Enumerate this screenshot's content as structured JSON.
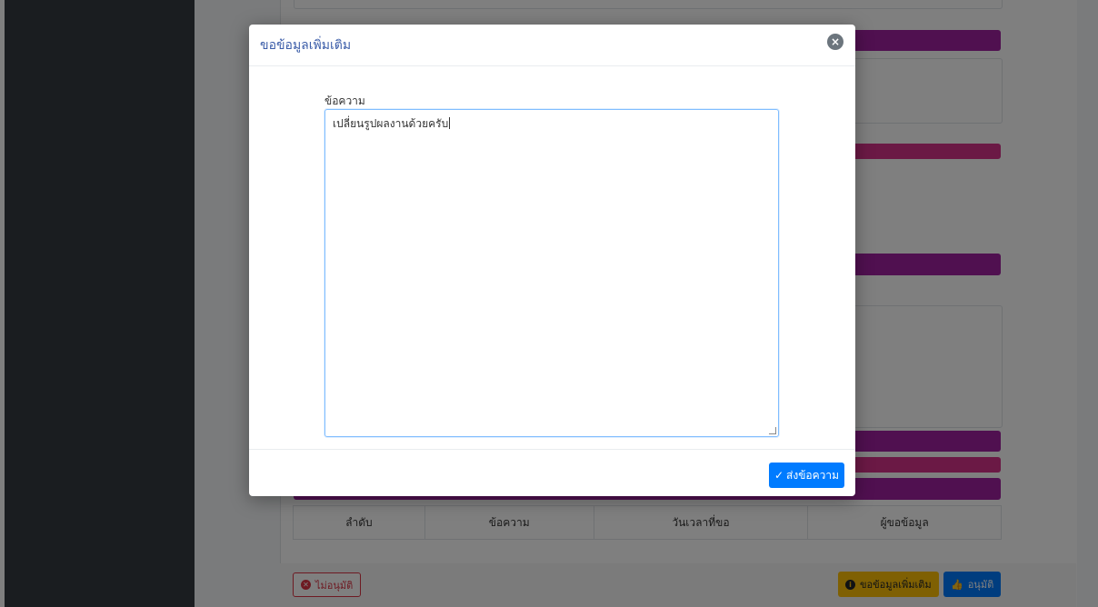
{
  "colors": {
    "sidebar": "#343a40",
    "accent_purple": "#a020a0",
    "accent_magenta": "#d6338a",
    "primary": "#007bff",
    "warning": "#ffc107",
    "danger": "#dc3545",
    "modal_title": "#3a5ca8"
  },
  "background": {
    "table": {
      "headers": [
        "ลำดับ",
        "ข้อความ",
        "วันเวลาที่ขอ",
        "ผู้ขอข้อมูล"
      ]
    },
    "footer": {
      "reject_label": "ไม่อนุมัติ",
      "request_info_label": "ขอข้อมูลเพิ่มเติม",
      "approve_label": "อนุมัติ"
    }
  },
  "modal": {
    "title": "ขอข้อมูลเพิ่มเติม",
    "field_label": "ข้อความ",
    "message_value": "เปลี่ยนรูปผลงานด้วยครับ",
    "submit_label": "ส่งข้อความ"
  },
  "icons": {
    "close": "close-icon",
    "check": "check-icon",
    "times_circle": "times-circle-icon",
    "info_circle": "info-circle-icon",
    "thumbs_up": "thumbs-up-icon"
  }
}
